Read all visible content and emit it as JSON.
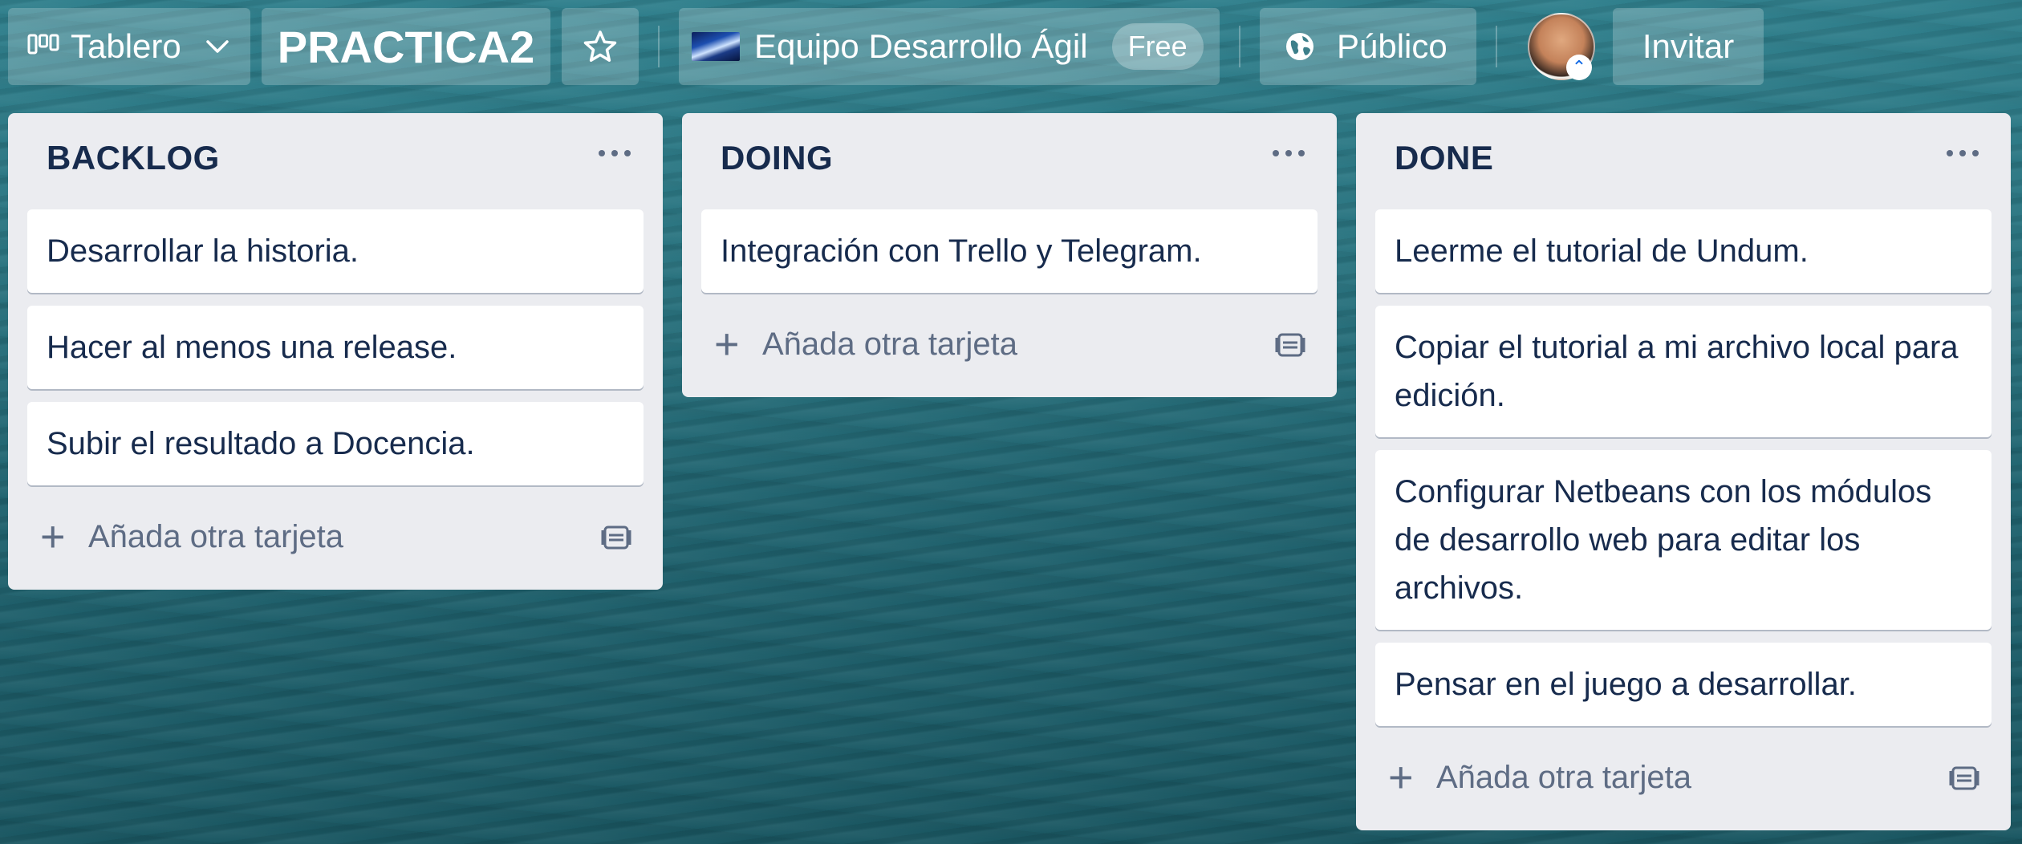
{
  "header": {
    "board_menu_label": "Tablero",
    "board_title": "PRACTICA2",
    "team_name": "Equipo Desarrollo Ágil",
    "team_plan": "Free",
    "visibility_label": "Público",
    "invite_label": "Invitar"
  },
  "lists": [
    {
      "title": "BACKLOG",
      "cards": [
        "Desarrollar la historia.",
        "Hacer al menos una release.",
        "Subir el resultado a Docencia."
      ],
      "add_label": "Añada otra tarjeta"
    },
    {
      "title": "DOING",
      "cards": [
        "Integración con Trello y Telegram."
      ],
      "add_label": "Añada otra tarjeta"
    },
    {
      "title": "DONE",
      "cards": [
        "Leerme el tutorial de Undum.",
        "Copiar el tutorial a mi archivo local para edición.",
        "Configurar Netbeans con los módulos de desarrollo web para editar los archivos.",
        "Pensar en el juego a desarrollar."
      ],
      "add_label": "Añada otra tarjeta"
    }
  ],
  "icons": {
    "board_menu": "board-columns-icon",
    "chevron": "chevron-down-icon",
    "star": "star-icon",
    "visibility": "globe-icon",
    "list_menu": "more-horizontal-icon",
    "add": "plus-icon",
    "template": "card-template-icon"
  },
  "colors": {
    "board_background": "#2a7480",
    "list_background": "#ebecf0",
    "card_background": "#ffffff",
    "text_primary": "#172b4d",
    "text_secondary": "#5e6c84"
  }
}
